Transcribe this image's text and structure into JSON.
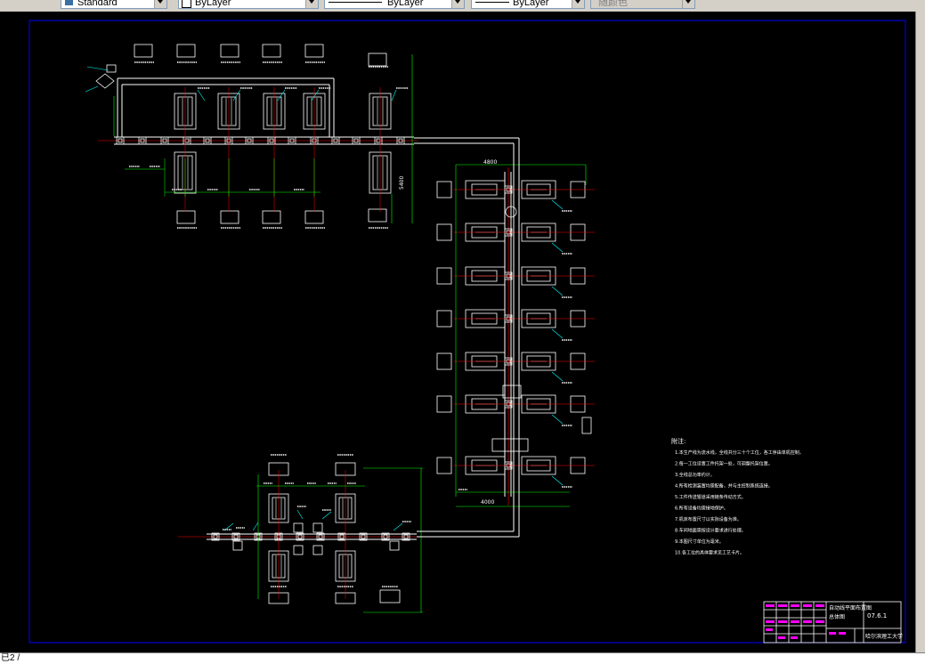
{
  "toolbar": {
    "textstyle": "Standard",
    "layer": "ByLayer",
    "linetype": "ByLayer",
    "lineweight": "ByLayer",
    "plotstyle": "随颜色"
  },
  "drawing": {
    "notes_title": "附注:",
    "notes": [
      "1.本生产线为流水线，全线共分三十个工位，各工序由单机控制，",
      "2.每一工位设置工件托架一处，可调整托架位置。",
      "3.全线总功率约计。",
      "4.所有检测装置均需配备，并与主控制系统连接。",
      "5.工件传送辊道采用链条传动方式。",
      "6.所有设备均需接地保护。",
      "7.机床布置尺寸以实际设备为准。",
      "8.车间地面需按设计要求进行处理。",
      "9.本图尺寸单位为毫米。",
      "10.各工位的具体要求见工艺卡片。"
    ],
    "title_block": {
      "title_line1": "自动线平面布置图",
      "title_line2": "总体图",
      "drawing_no": "07.6.1",
      "school": "哈尔滨理工大学"
    },
    "dimensions": {
      "top_total": "4800",
      "right_total": "5400",
      "bottom_width": "4000"
    }
  },
  "status": {
    "text": "已2 /"
  },
  "colors": {
    "background": "#000000",
    "frame": "#0000ff",
    "line": "#ffffff",
    "dimension": "#00ff00",
    "centerline": "#ff0000",
    "leader": "#00ffff",
    "annotation": "#ffff00",
    "title_text": "#ff00ff"
  }
}
